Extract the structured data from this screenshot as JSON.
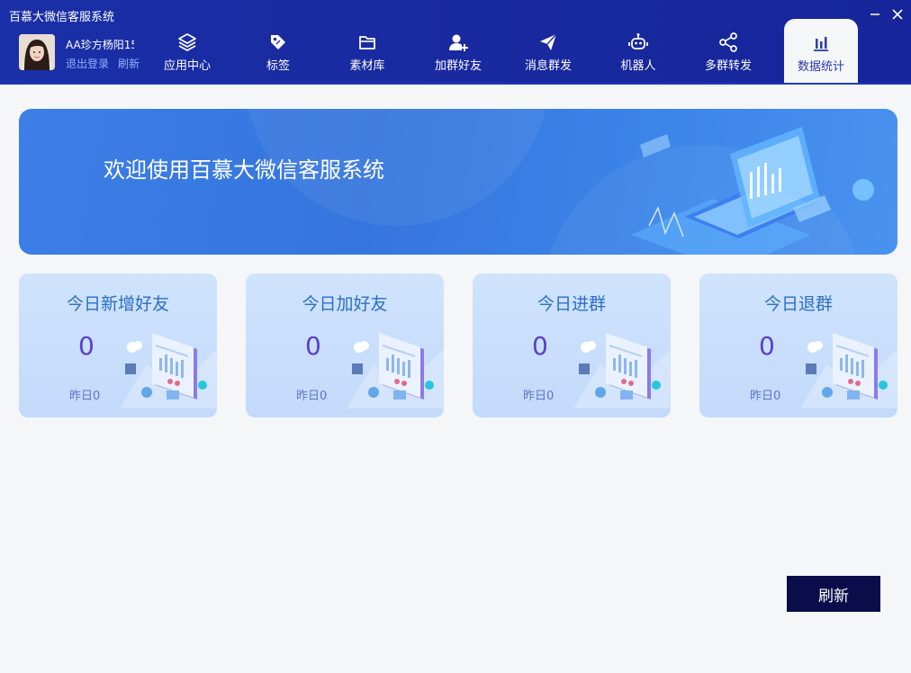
{
  "window": {
    "title": "百慕大微信客服系统"
  },
  "user": {
    "name": "AA珍方杨阳15",
    "logout_label": "退出登录",
    "refresh_label": "刷新"
  },
  "nav": {
    "items": [
      {
        "label": "应用中心",
        "icon": "layers-icon"
      },
      {
        "label": "标签",
        "icon": "tag-icon"
      },
      {
        "label": "素材库",
        "icon": "folder-icon"
      },
      {
        "label": "加群好友",
        "icon": "add-user-icon"
      },
      {
        "label": "消息群发",
        "icon": "paper-plane-icon"
      },
      {
        "label": "机器人",
        "icon": "robot-icon"
      },
      {
        "label": "多群转发",
        "icon": "share-icon"
      },
      {
        "label": "数据统计",
        "icon": "bar-chart-icon"
      }
    ],
    "active_index": 7
  },
  "banner": {
    "title": "欢迎使用百慕大微信客服系统"
  },
  "stats": [
    {
      "title": "今日新增好友",
      "value": "0",
      "yesterday": "昨日0"
    },
    {
      "title": "今日加好友",
      "value": "0",
      "yesterday": "昨日0"
    },
    {
      "title": "今日进群",
      "value": "0",
      "yesterday": "昨日0"
    },
    {
      "title": "今日退群",
      "value": "0",
      "yesterday": "昨日0"
    }
  ],
  "actions": {
    "refresh_label": "刷新"
  },
  "colors": {
    "header": "#1a2fa8",
    "accent": "#2d6ec4",
    "refresh_button": "#0b0c4a"
  }
}
